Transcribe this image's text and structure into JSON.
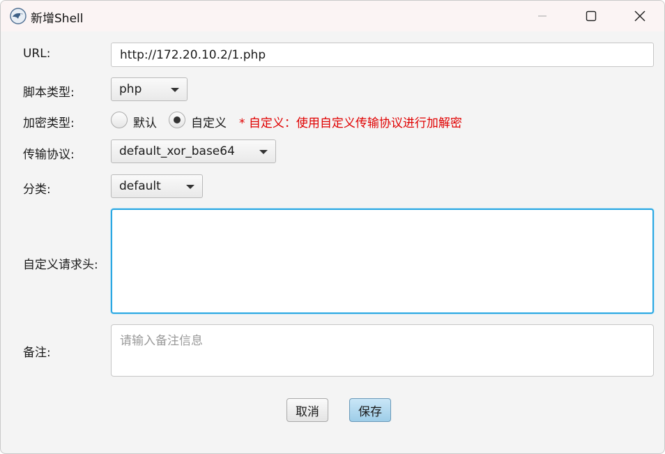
{
  "window": {
    "title": "新增Shell"
  },
  "form": {
    "url": {
      "label": "URL:",
      "value": "http://172.20.10.2/1.php"
    },
    "script_type": {
      "label": "脚本类型:",
      "selected": "php"
    },
    "encrypt_type": {
      "label": "加密类型:",
      "options": [
        {
          "label": "默认",
          "checked": false
        },
        {
          "label": "自定义",
          "checked": true
        }
      ],
      "hint": "* 自定义：使用自定义传输协议进行加解密"
    },
    "protocol": {
      "label": "传输协议:",
      "selected": "default_xor_base64"
    },
    "category": {
      "label": "分类:",
      "selected": "default"
    },
    "custom_headers": {
      "label": "自定义请求头:",
      "value": ""
    },
    "remark": {
      "label": "备注:",
      "placeholder": "请输入备注信息"
    }
  },
  "buttons": {
    "cancel": "取消",
    "save": "保存"
  },
  "colors": {
    "hint": "#e00000",
    "focus_border": "#2aa7e2",
    "save_button": "#9ecde8"
  }
}
